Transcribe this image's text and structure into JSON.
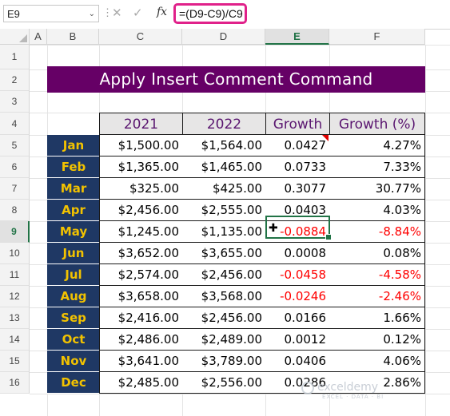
{
  "formula_bar": {
    "name_box": "E9",
    "fx_label": "fx",
    "formula": "=(D9-C9)/C9"
  },
  "columns": [
    "A",
    "B",
    "C",
    "D",
    "E",
    "F"
  ],
  "rows": [
    "1",
    "2",
    "3",
    "4",
    "5",
    "6",
    "7",
    "8",
    "9",
    "10",
    "11",
    "12",
    "13",
    "14",
    "15",
    "16"
  ],
  "selected_column": "E",
  "selected_row": "9",
  "title": "Apply Insert Comment Command",
  "table": {
    "headers": [
      "2021",
      "2022",
      "Growth",
      "Growth (%)"
    ],
    "rows": [
      {
        "month": "Jan",
        "y2021": "$1,500.00",
        "y2022": "$1,564.00",
        "growth": "0.0427",
        "pct": "4.27%",
        "negative": false
      },
      {
        "month": "Feb",
        "y2021": "$1,365.00",
        "y2022": "$1,465.00",
        "growth": "0.0733",
        "pct": "7.33%",
        "negative": false
      },
      {
        "month": "Mar",
        "y2021": "$325.00",
        "y2022": "$425.00",
        "growth": "0.3077",
        "pct": "30.77%",
        "negative": false
      },
      {
        "month": "Apr",
        "y2021": "$2,456.00",
        "y2022": "$2,555.00",
        "growth": "0.0403",
        "pct": "4.03%",
        "negative": false
      },
      {
        "month": "May",
        "y2021": "$1,245.00",
        "y2022": "$1,135.00",
        "growth": "-0.0884",
        "pct": "-8.84%",
        "negative": true
      },
      {
        "month": "Jun",
        "y2021": "$3,652.00",
        "y2022": "$3,655.00",
        "growth": "0.0008",
        "pct": "0.08%",
        "negative": false
      },
      {
        "month": "Jul",
        "y2021": "$2,574.00",
        "y2022": "$2,456.00",
        "growth": "-0.0458",
        "pct": "-4.58%",
        "negative": true
      },
      {
        "month": "Aug",
        "y2021": "$3,658.00",
        "y2022": "$3,568.00",
        "growth": "-0.0246",
        "pct": "-2.46%",
        "negative": true
      },
      {
        "month": "Sep",
        "y2021": "$2,416.00",
        "y2022": "$2,456.00",
        "growth": "0.0166",
        "pct": "1.66%",
        "negative": false
      },
      {
        "month": "Oct",
        "y2021": "$2,486.00",
        "y2022": "$2,489.00",
        "growth": "0.0012",
        "pct": "0.12%",
        "negative": false
      },
      {
        "month": "Nov",
        "y2021": "$3,641.00",
        "y2022": "$3,789.00",
        "growth": "0.0406",
        "pct": "4.06%",
        "negative": false
      },
      {
        "month": "Dec",
        "y2021": "$2,485.00",
        "y2022": "$2,556.00",
        "growth": "0.0286",
        "pct": "2.86%",
        "negative": false
      }
    ]
  },
  "watermark": {
    "name": "exceldemy",
    "tagline": "EXCEL · DATA · BI"
  },
  "colors": {
    "title_bg": "#660066",
    "month_bg": "#1f3864",
    "month_text": "#f2c200",
    "header_text": "#5a1670",
    "negative": "#ff0000",
    "selection": "#217346",
    "formula_highlight": "#e0218a"
  }
}
